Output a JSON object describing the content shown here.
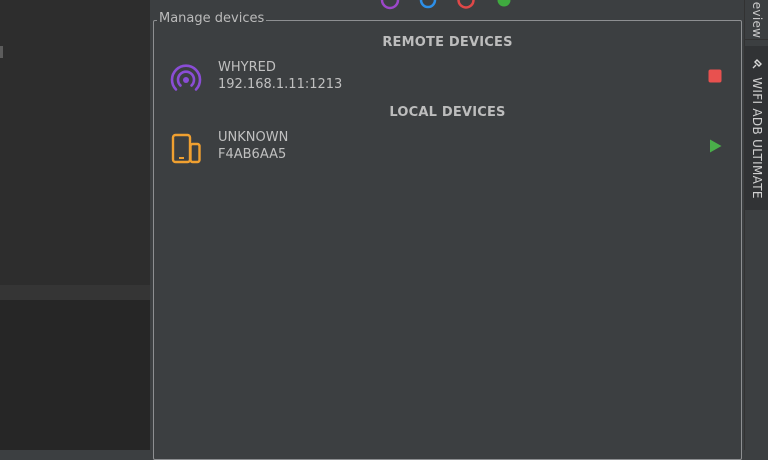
{
  "panel": {
    "title": "Manage devices"
  },
  "sections": {
    "remote_header": "REMOTE DEVICES",
    "local_header": "LOCAL DEVICES"
  },
  "remote_devices": [
    {
      "name": "WHYRED",
      "address": "192.168.1.11:1213",
      "icon": "wifi-signal-icon",
      "action": "stop-icon",
      "icon_color": "#8a4dd6",
      "action_color": "#e8514f"
    }
  ],
  "local_devices": [
    {
      "name": "UNKNOWN",
      "serial": "F4AB6AA5",
      "icon": "phone-tablet-icon",
      "action": "play-icon",
      "icon_color": "#f0a030",
      "action_color": "#4aae4a"
    }
  ],
  "toolbar": {
    "icons": [
      "purple-circle-icon",
      "blue-refresh-icon",
      "red-circle-icon",
      "green-dot-icon"
    ],
    "colors": [
      "#9c47c9",
      "#2d8fe8",
      "#e04848",
      "#3faa3f"
    ]
  },
  "side_tabs": {
    "top_label": "eview",
    "active_label": "WIFI ADB ULTIMATE",
    "active_icon": "usb-plug-icon"
  }
}
